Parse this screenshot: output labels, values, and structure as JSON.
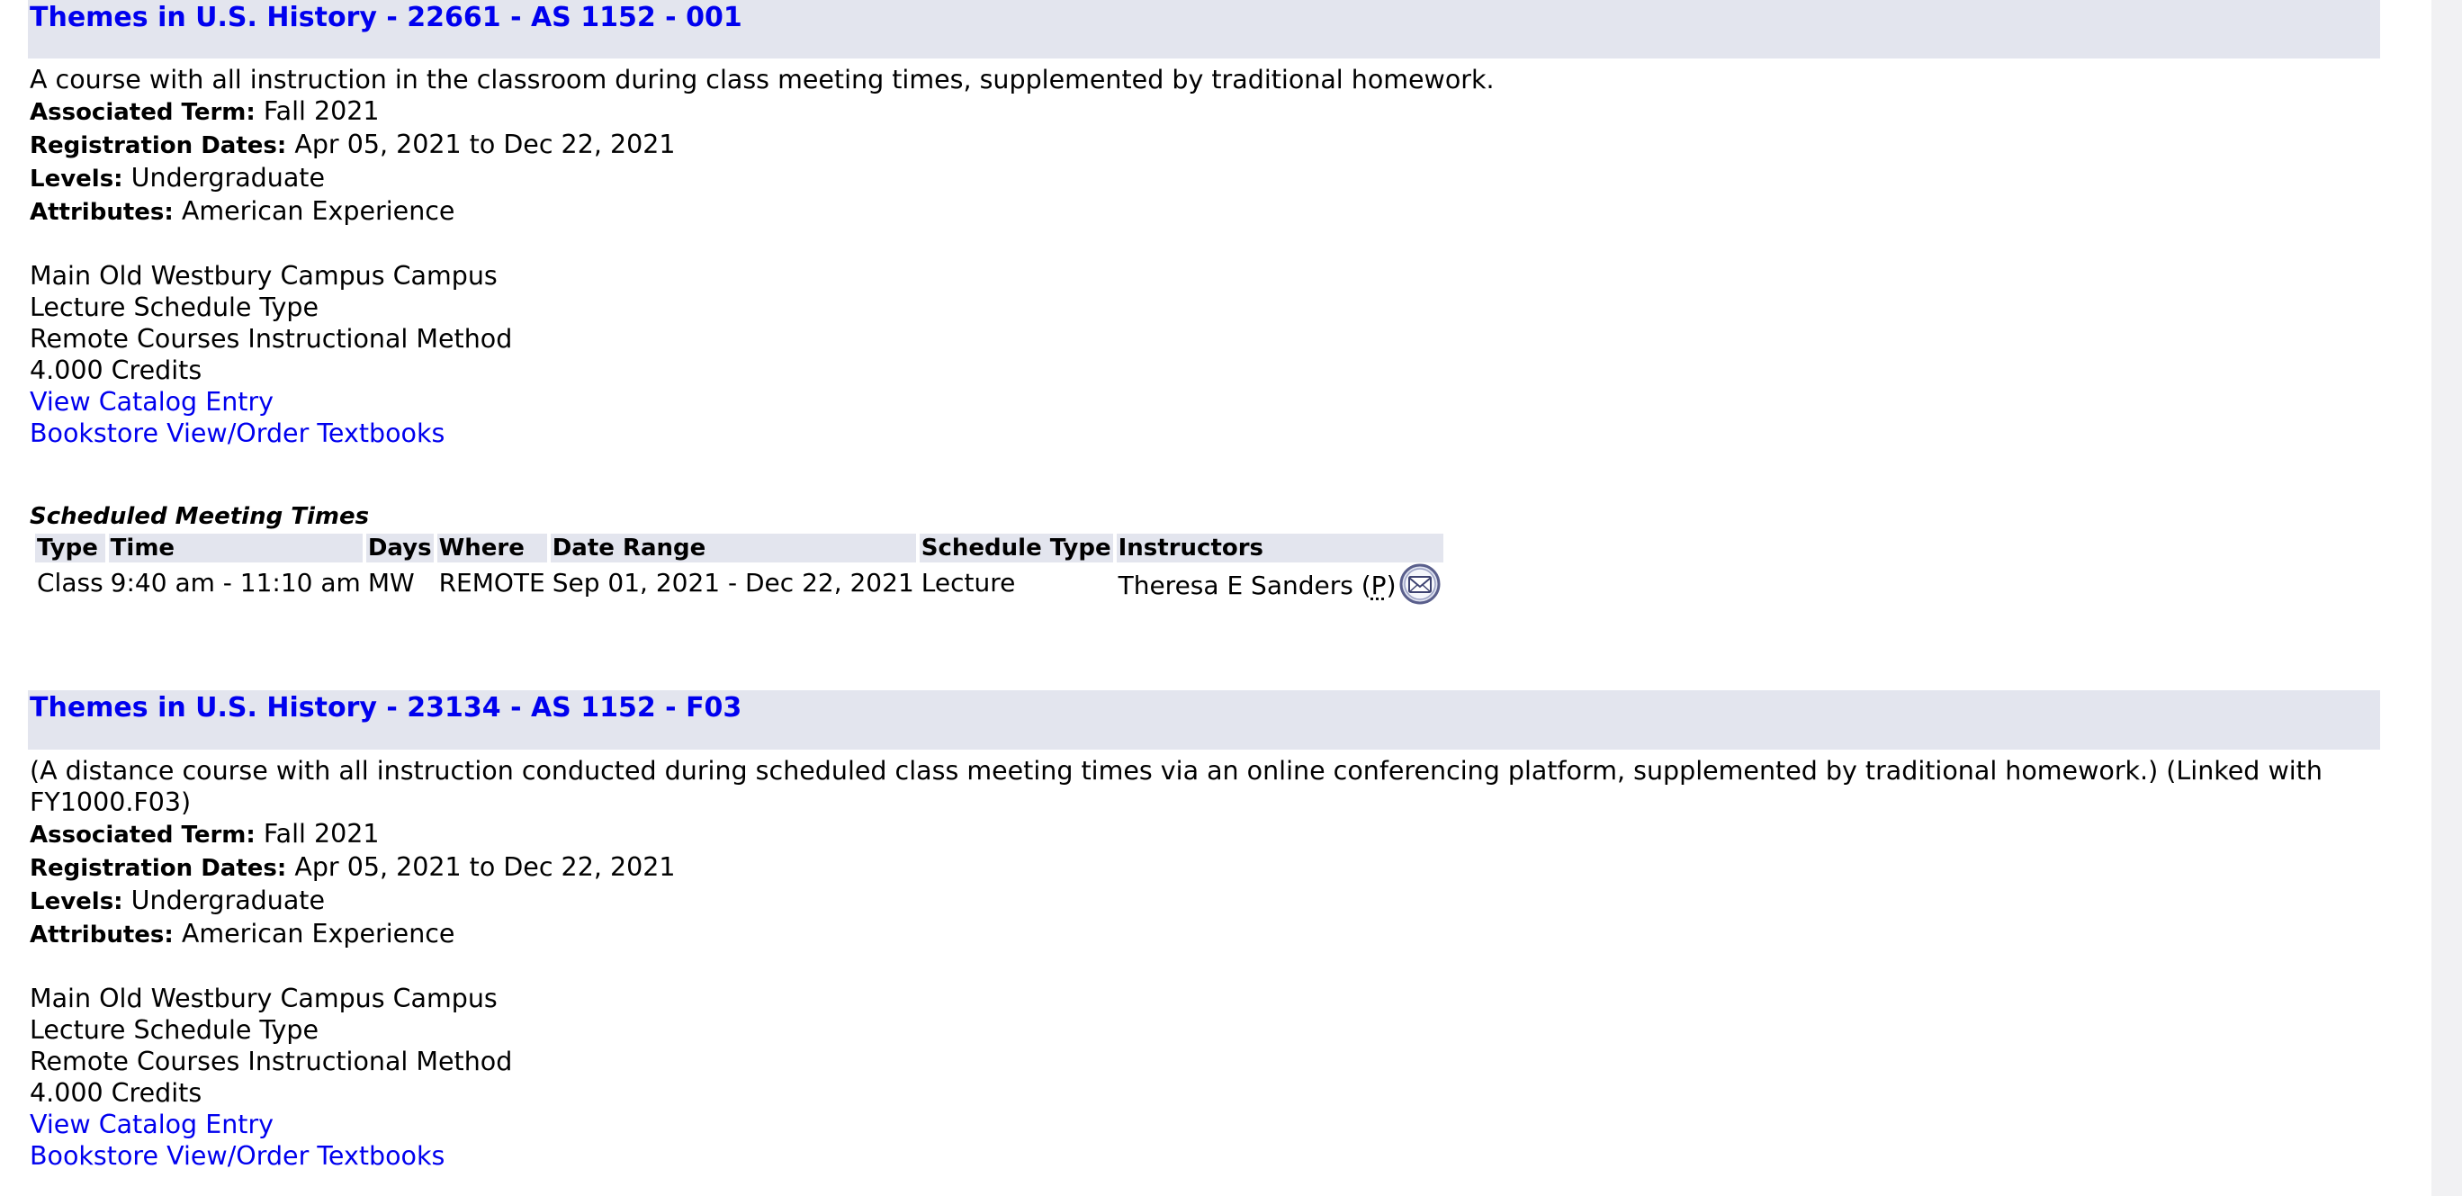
{
  "sections": [
    {
      "title": "Themes in U.S. History - 22661 - AS 1152 - 001",
      "description": "A course with all instruction in the classroom during class meeting times, supplemented by traditional homework.",
      "associated_term_label": "Associated Term:",
      "associated_term": "Fall 2021",
      "registration_dates_label": "Registration Dates:",
      "registration_dates": "Apr 05, 2021 to Dec 22, 2021",
      "levels_label": "Levels:",
      "levels": "Undergraduate",
      "attributes_label": "Attributes:",
      "attributes": "American Experience",
      "campus": "Main Old Westbury Campus Campus",
      "schedule_type": "Lecture Schedule Type",
      "instructional_method": "Remote Courses Instructional Method",
      "credits": "4.000 Credits",
      "catalog_link": "View Catalog Entry",
      "bookstore_link": "Bookstore View/Order Textbooks",
      "meeting_times": {
        "caption": "Scheduled Meeting Times",
        "headers": [
          "Type",
          "Time",
          "Days",
          "Where",
          "Date Range",
          "Schedule Type",
          "Instructors"
        ],
        "rows": [
          {
            "type": "Class",
            "time": "9:40 am - 11:10 am",
            "days": "MW",
            "where": "REMOTE",
            "date_range": "Sep 01, 2021 - Dec 22, 2021",
            "schedule_type": "Lecture",
            "instructor": "Theresa E Sanders",
            "primary_open": "(",
            "primary_mark": "P",
            "primary_close": ")"
          }
        ]
      }
    },
    {
      "title": "Themes in U.S. History - 23134 - AS 1152 - F03",
      "description": "(A distance course with all instruction conducted during scheduled class meeting times via an online conferencing platform, supplemented by traditional homework.) (Linked with FY1000.F03)",
      "associated_term_label": "Associated Term:",
      "associated_term": "Fall 2021",
      "registration_dates_label": "Registration Dates:",
      "registration_dates": "Apr 05, 2021 to Dec 22, 2021",
      "levels_label": "Levels:",
      "levels": "Undergraduate",
      "attributes_label": "Attributes:",
      "attributes": "American Experience",
      "campus": "Main Old Westbury Campus Campus",
      "schedule_type": "Lecture Schedule Type",
      "instructional_method": "Remote Courses Instructional Method",
      "credits": "4.000 Credits",
      "catalog_link": "View Catalog Entry",
      "bookstore_link": "Bookstore View/Order Textbooks"
    }
  ],
  "colors": {
    "link": "#0000ee",
    "header_background": "#e3e5ee",
    "scroll_gutter": "#f1f1f3"
  },
  "icons": {
    "email": "envelope-email-icon"
  }
}
